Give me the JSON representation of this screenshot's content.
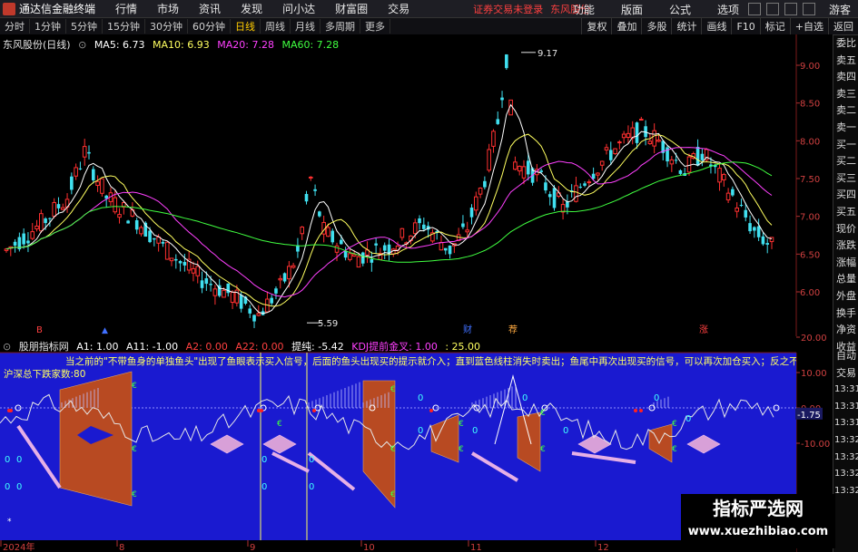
{
  "app": {
    "title": "通达信金融终端",
    "menus": [
      "行情",
      "市场",
      "资讯",
      "发现",
      "问小达",
      "财富圈",
      "交易"
    ],
    "login_status": "证券交易未登录",
    "stock_tag": "东风股份",
    "right_menus": [
      "功能",
      "版面",
      "公式",
      "选项"
    ],
    "guest": "游客"
  },
  "period_bar": {
    "periods": [
      "分时",
      "1分钟",
      "5分钟",
      "15分钟",
      "30分钟",
      "60分钟",
      "日线",
      "周线",
      "月线",
      "多周期",
      "更多"
    ],
    "active": "日线",
    "right_buttons": [
      "复权",
      "叠加",
      "多股",
      "统计",
      "画线",
      "F10",
      "标记",
      "+自选",
      "返回"
    ]
  },
  "main_chart": {
    "stock_label": "东风股份(日线)",
    "ma5": "MA5: 6.73",
    "ma10": "MA10: 6.93",
    "ma20": "MA20: 7.28",
    "ma60": "MA60: 7.28",
    "price_axis": [
      "9.00",
      "8.50",
      "8.00",
      "7.50",
      "7.00",
      "6.50",
      "6.00"
    ],
    "high_label": "9.17",
    "low_label": "5.59",
    "markers": [
      "B",
      "财",
      "荐",
      "涨"
    ]
  },
  "sub_chart": {
    "indicator_name": "股朋指标网",
    "a1": "A1: 1.00",
    "a11": "A11: -1.00",
    "a2": "A2: 0.00",
    "a22": "A22: 0.00",
    "tichun": "提纯: -5.42",
    "kdj": "KDJ提前金叉: 1.00",
    "kdj_value": ": 25.00",
    "scroll_text": "当之前的\"不带鱼身的单独鱼头\"出现了鱼眼表示买入信号，后面的鱼头出现买的提示就介入；直到蓝色线柱消失时卖出；鱼尾中再次出现买的信号，可以再次加仓买入；反之不买，角度的选",
    "counter_text": "沪深总下跌家数:80",
    "axis": [
      "20.00",
      "10.00",
      "0.00",
      "-1.75",
      "-10.00"
    ],
    "current_value": "-1.75",
    "glyph_zero": "0",
    "glyph_euro": "€"
  },
  "time_axis": {
    "labels": [
      "2024年",
      "8",
      "9",
      "10",
      "11",
      "12"
    ]
  },
  "side_panel": {
    "top_label": "委比",
    "items": [
      "委比",
      "卖五",
      "卖四",
      "卖三",
      "卖二",
      "卖一",
      "买一",
      "买二",
      "买三",
      "买四",
      "买五",
      "现价",
      "涨跌",
      "涨幅",
      "总量",
      "外盘",
      "换手",
      "净资",
      "收益"
    ],
    "items2": [
      "自动",
      "交易"
    ],
    "times": [
      "13:31",
      "13:31",
      "13:31",
      "13:32",
      "13:32",
      "13:32",
      "13:32"
    ]
  },
  "watermark": {
    "title": "指标严选网",
    "url": "www.xuezhibiao.com"
  },
  "colors": {
    "up": "#ff3030",
    "down": "#40e0f0",
    "ma5": "#ffffff",
    "ma10": "#ffff60",
    "ma20": "#ff40ff",
    "ma60": "#40ff40",
    "sub_bg": "#1a1ad0",
    "fish": "#b84a22"
  }
}
